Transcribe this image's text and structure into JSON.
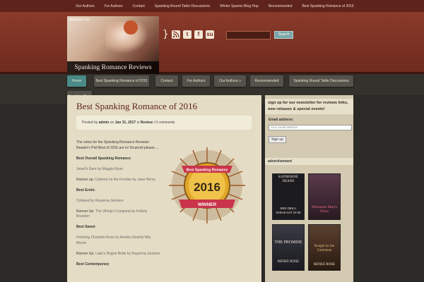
{
  "top_nav": [
    "Our Authors",
    "For Authors",
    "Contact",
    "Spanking Round Table Discussions",
    "Winter Spanks Blog Hop",
    "Recommended",
    "Best Spanking Romance of 2015"
  ],
  "header": {
    "logo_tag": "Spanking Toys",
    "logo_title": "Spanking Romance Reviews",
    "social_icons": [
      "rss-icon",
      "twitter-icon",
      "facebook-icon",
      "stumbleupon-icon"
    ],
    "search_button": "Search"
  },
  "main_nav": {
    "items": [
      "Home",
      "Best Spanking Romance of 2015",
      "Contact",
      "For Authors",
      "Our Authors »",
      "Recommended",
      "Spanking Round Table Discussions",
      "Spanking Toys"
    ],
    "active_index": 0
  },
  "post": {
    "title": "Best Spanking Romance of 2016",
    "meta_posted_by": "Posted by",
    "meta_author": "admin",
    "meta_on": "on",
    "meta_date": "Jan 31, 2017",
    "meta_in": "in",
    "meta_category": "Review",
    "meta_comments": "| 0 comments",
    "intro": "The votes for the Spanking Romance Reviews Reader's Poll Best of 2016 are in! Drumroll please....",
    "sections": [
      {
        "heading": "Best Overall Spanking Romance",
        "winner": "Jewel's Gem by Maggie Ryan",
        "runner_label": "Runner up:",
        "runner": "Claimed on the Frontier by Jane Henry"
      },
      {
        "heading": "Best Erotic",
        "winner": "Collared by Rayanna Jamison",
        "runner_label": "Runner Up:",
        "runner": "The Viking's Conquest by Felicity Brandon"
      },
      {
        "heading": "Best Sweet",
        "winner": "Fetching Charlotte Rose by Amelia Smarts/ Mia Moore",
        "runner_label": "Runner Up:",
        "runner": "Luke's Rogue Bride by Rayanna Jamison"
      },
      {
        "heading": "Best Contemporary",
        "winner": "",
        "runner_label": "",
        "runner": ""
      }
    ],
    "badge": {
      "top_text": "Best Spanking Romance",
      "year": "2016",
      "ribbon": "WINNER"
    }
  },
  "sidebar": {
    "newsletter_heading": "sign up for our newsletter for reviews links, new releases & special events!",
    "email_label": "Email address:",
    "email_placeholder": "Your email address",
    "signup_button": "Sign up",
    "advertisement_heading": "advertisement",
    "books": [
      {
        "author": "KATHERINE DEANE",
        "title": "HER DRILL SERGEANT DOM",
        "color": "#1c1b20"
      },
      {
        "author": "",
        "title": "Mountain Man's Slave",
        "color": "#3a2a36"
      },
      {
        "author": "RENEE ROSE",
        "title": "THE PROMISE",
        "color": "#2a2a30"
      },
      {
        "author": "RENEE ROSE",
        "title": "Bought by the Cattleman",
        "color": "#3a2a1e"
      }
    ],
    "second_row_author": "RENEE ROSE"
  },
  "colors": {
    "top_nav": "#5e231a",
    "header": "#7d3324",
    "active_tab": "#4a8a87",
    "content_bg": "#e4dcc4",
    "title": "#5e231a"
  }
}
